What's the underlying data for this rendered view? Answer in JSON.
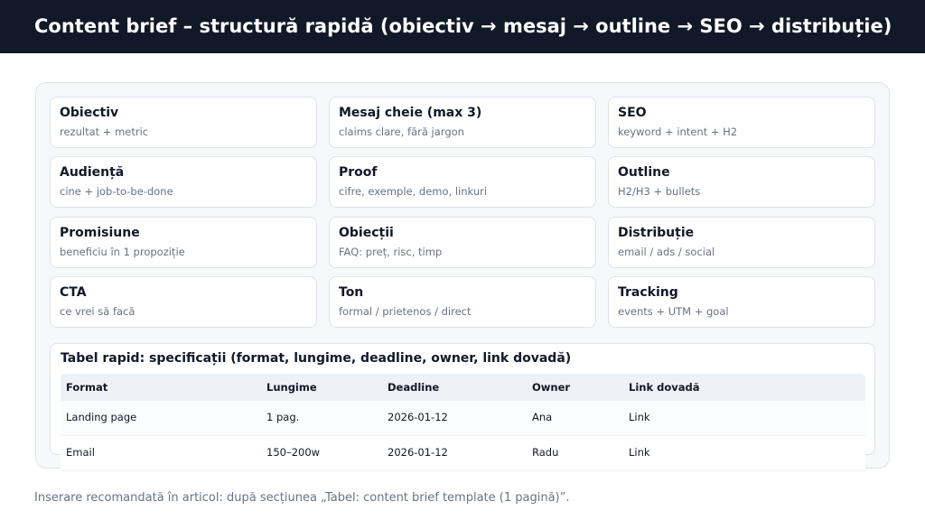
{
  "header": {
    "title": "Content brief – structură rapidă (obiectiv → mesaj → outline → SEO → distribuție)"
  },
  "cards": [
    {
      "title": "Obiectiv",
      "subtitle": "rezultat + metric"
    },
    {
      "title": "Mesaj cheie (max 3)",
      "subtitle": "claims clare, fără jargon"
    },
    {
      "title": "SEO",
      "subtitle": "keyword + intent + H2"
    },
    {
      "title": "Audiență",
      "subtitle": "cine + job-to-be-done"
    },
    {
      "title": "Proof",
      "subtitle": "cifre, exemple, demo, linkuri"
    },
    {
      "title": "Outline",
      "subtitle": "H2/H3 + bullets"
    },
    {
      "title": "Promisiune",
      "subtitle": "beneficiu în 1 propoziție"
    },
    {
      "title": "Obiecții",
      "subtitle": "FAQ: preț, risc, timp"
    },
    {
      "title": "Distribuție",
      "subtitle": "email / ads / social"
    },
    {
      "title": "CTA",
      "subtitle": "ce vrei să facă"
    },
    {
      "title": "Ton",
      "subtitle": "formal / prietenos / direct"
    },
    {
      "title": "Tracking",
      "subtitle": "events + UTM + goal"
    }
  ],
  "table": {
    "title": "Tabel rapid: specificații (format, lungime, deadline, owner, link dovadă)",
    "headers": [
      "Format",
      "Lungime",
      "Deadline",
      "Owner",
      "Link dovadă"
    ],
    "rows": [
      [
        "Landing page",
        "1 pag.",
        "2026-01-12",
        "Ana",
        "Link"
      ],
      [
        "Email",
        "150–200w",
        "2026-01-12",
        "Radu",
        "Link"
      ]
    ]
  },
  "footer": {
    "note": "Inserare recomandată în articol: după secțiunea „Tabel: content brief template (1 pagină)”."
  }
}
